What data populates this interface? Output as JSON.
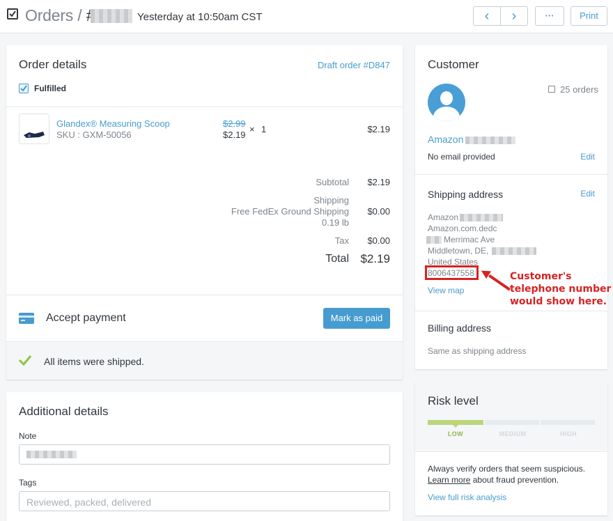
{
  "header": {
    "title": "Orders",
    "separator": "/",
    "hash": "#",
    "timestamp": "Yesterday at 10:50am CST",
    "print_label": "Print",
    "more_label": "···",
    "prev_label": "‹",
    "next_label": "›"
  },
  "order_details": {
    "heading": "Order details",
    "draft_link": "Draft order #D847",
    "status": "Fulfilled",
    "item": {
      "name": "Glandex® Measuring Scoop",
      "sku": "SKU : GXM-50056",
      "original_price": "$2.99",
      "price": "$2.19",
      "times": "×",
      "quantity": "1",
      "total": "$2.19"
    },
    "summary": {
      "subtotal_label": "Subtotal",
      "subtotal_value": "$2.19",
      "shipping_label": "Shipping",
      "shipping_method": "Free FedEx Ground Shipping",
      "shipping_weight": "0.19 lb",
      "shipping_value": "$0.00",
      "tax_label": "Tax",
      "tax_value": "$0.00",
      "total_label": "Total",
      "total_value": "$2.19"
    },
    "payment_label": "Accept payment",
    "mark_paid_label": "Mark as paid",
    "shipped_text": "All items were shipped."
  },
  "additional_details": {
    "heading": "Additional details",
    "note_label": "Note",
    "tags_label": "Tags",
    "tags_placeholder": "Reviewed, packed, delivered"
  },
  "customer": {
    "heading": "Customer",
    "orders_count": "25 orders",
    "name": "Amazon",
    "email": "No email provided",
    "edit_label": "Edit",
    "shipping_heading": "Shipping address",
    "shipping_edit_label": "Edit",
    "address_name": "Amazon",
    "address_company": "Amazon.com.dedc",
    "address_street": "Merrimac Ave",
    "address_city": "Middletown, DE,",
    "address_country": "United States",
    "phone": "8006437558",
    "view_map": "View map",
    "billing_heading": "Billing address",
    "billing_text": "Same as shipping address"
  },
  "annotation": {
    "line1": "Customer's",
    "line2": "telephone number",
    "line3": "would show here."
  },
  "risk": {
    "heading": "Risk level",
    "low": "LOW",
    "medium": "MEDIUM",
    "high": "HIGH",
    "level": "low",
    "warning": "Always verify orders that seem suspicious.",
    "learn_more": "Learn more",
    "learn_more_suffix": "about fraud prevention.",
    "full_analysis": "View full risk analysis"
  },
  "colors": {
    "accent": "#479ccf",
    "low_risk": "#bad67a",
    "annotation_red": "#d62323"
  }
}
